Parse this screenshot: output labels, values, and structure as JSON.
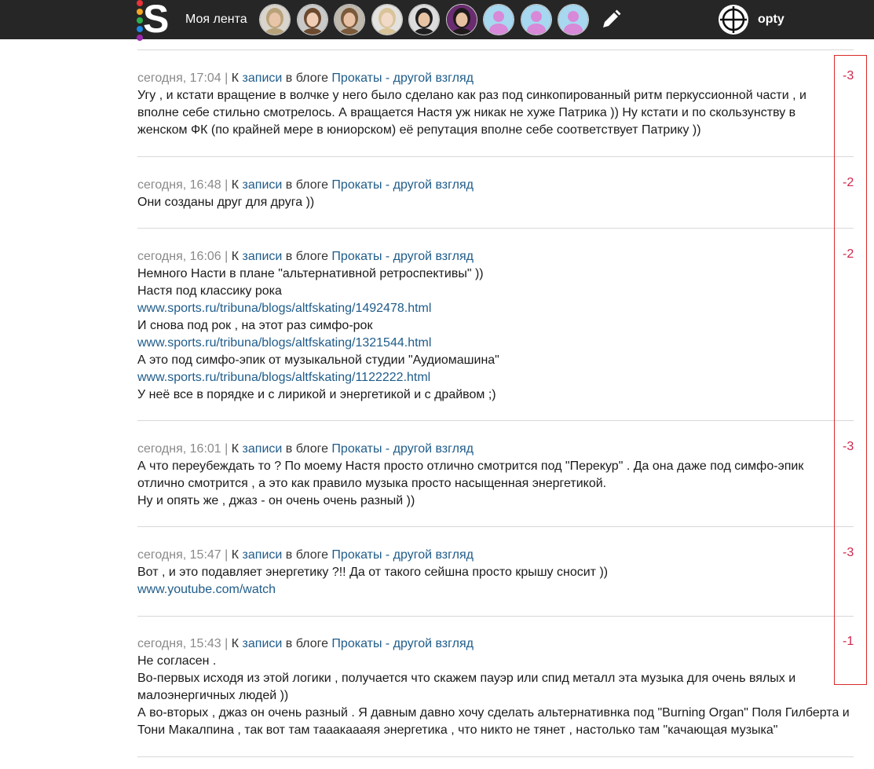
{
  "header": {
    "logo_letter": "S",
    "logo_dot_colors": [
      "#e8333a",
      "#f5a623",
      "#2bb24c",
      "#1e88e5",
      "#9c27b0"
    ],
    "feed_label": "Моя лента",
    "avatars": [
      {
        "name": "avatar-1",
        "kind": "photo",
        "bg": "#d9d4cc",
        "skin": "#e8c4a8",
        "hair": "#b8a27a"
      },
      {
        "name": "avatar-2",
        "kind": "photo",
        "bg": "#c9c9c9",
        "skin": "#f0cdb5",
        "hair": "#6b4a2f"
      },
      {
        "name": "avatar-3",
        "kind": "photo",
        "bg": "#bfb8ad",
        "skin": "#e9c2a6",
        "hair": "#7a5a3a"
      },
      {
        "name": "avatar-4",
        "kind": "photo",
        "bg": "#e4e2df",
        "skin": "#f2dac8",
        "hair": "#d9c49a"
      },
      {
        "name": "avatar-5",
        "kind": "photo",
        "bg": "#dcdcdc",
        "skin": "#e7c3a3",
        "hair": "#1f1f1f"
      },
      {
        "name": "avatar-6",
        "kind": "photo",
        "bg": "#6a2c70",
        "skin": "#e6c0a0",
        "hair": "#1f1a1a"
      },
      {
        "name": "avatar-7",
        "kind": "default",
        "bg": "#a7d8f0",
        "skin": "#d889d8"
      },
      {
        "name": "avatar-8",
        "kind": "default",
        "bg": "#a7d8f0",
        "skin": "#d889d8"
      },
      {
        "name": "avatar-9",
        "kind": "default",
        "bg": "#a7d8f0",
        "skin": "#d889d8"
      }
    ],
    "pencil_icon": "pencil-icon",
    "username": "opty"
  },
  "comments": [
    {
      "time": "сегодня, 17:04",
      "pipe": "|",
      "prefix": "К",
      "link": "записи",
      "mid": "в блоге",
      "blog": "Прокаты - другой взгляд",
      "score": "-3",
      "lines": [
        {
          "text": "Угу , и кстати вращение в волчке у него было сделано как раз под синкопированный ритм перкуссионной части , и",
          "link": false
        },
        {
          "text": "вполне себе стильно смотрелось. А вращается Настя уж никак не хуже Патрика )) Ну кстати и по скользунству в",
          "link": false
        },
        {
          "text": "женском ФК (по крайней мере в юниорском) её репутация вполне себе соответствует Патрику ))",
          "link": false
        }
      ]
    },
    {
      "time": "сегодня, 16:48",
      "pipe": "|",
      "prefix": "К",
      "link": "записи",
      "mid": "в блоге",
      "blog": "Прокаты - другой взгляд",
      "score": "-2",
      "lines": [
        {
          "text": "Они созданы друг для друга ))",
          "link": false
        }
      ]
    },
    {
      "time": "сегодня, 16:06",
      "pipe": "|",
      "prefix": "К",
      "link": "записи",
      "mid": "в блоге",
      "blog": "Прокаты - другой взгляд",
      "score": "-2",
      "lines": [
        {
          "text": "Немного Насти в плане \"альтернативной ретроспективы\" ))",
          "link": false
        },
        {
          "text": "Настя под классику рока",
          "link": false
        },
        {
          "text": "www.sports.ru/tribuna/blogs/altfskating/1492478.html",
          "link": true
        },
        {
          "text": "И снова под рок , на этот раз симфо-рок",
          "link": false
        },
        {
          "text": "www.sports.ru/tribuna/blogs/altfskating/1321544.html",
          "link": true
        },
        {
          "text": "А это под симфо-эпик от музыкальной студии \"Аудиомашина\"",
          "link": false
        },
        {
          "text": "www.sports.ru/tribuna/blogs/altfskating/1122222.html",
          "link": true
        },
        {
          "text": "У неё все в порядке и с лирикой и энергетикой и с драйвом ;)",
          "link": false
        }
      ]
    },
    {
      "time": "сегодня, 16:01",
      "pipe": "|",
      "prefix": "К",
      "link": "записи",
      "mid": "в блоге",
      "blog": "Прокаты - другой взгляд",
      "score": "-3",
      "lines": [
        {
          "text": "А что переубеждать то ? По моему Настя просто отлично смотрится под \"Перекур\" . Да она даже под симфо-эпик",
          "link": false
        },
        {
          "text": "отлично смотрится , а это как правило музыка просто насыщенная энергетикой.",
          "link": false
        },
        {
          "text": "Ну и опять же , джаз - он очень очень разный ))",
          "link": false
        }
      ]
    },
    {
      "time": "сегодня, 15:47",
      "pipe": "|",
      "prefix": "К",
      "link": "записи",
      "mid": "в блоге",
      "blog": "Прокаты - другой взгляд",
      "score": "-3",
      "lines": [
        {
          "text": "Вот , и это подавляет энергетику ?!! Да от такого сейшна просто крышу сносит ))",
          "link": false
        },
        {
          "text": "www.youtube.com/watch",
          "link": true
        }
      ]
    },
    {
      "time": "сегодня, 15:43",
      "pipe": "|",
      "prefix": "К",
      "link": "записи",
      "mid": "в блоге",
      "blog": "Прокаты - другой взгляд",
      "score": "-1",
      "lines": [
        {
          "text": "Не согласен .",
          "link": false
        },
        {
          "text": "Во-первых исходя из этой логики , получается что скажем пауэр или спид металл эта музыка для очень вялых и",
          "link": false
        },
        {
          "text": "малоэнергичных людей ))",
          "link": false
        },
        {
          "text": "А во-вторых , джаз он очень разный . Я давным давно хочу сделать альтернативнка под \"Burning Organ\" Поля Гилберта и",
          "link": false
        },
        {
          "text": "Тони Макалпина , так вот там тааакаааяя энергетика , что никто не тянет , настолько там \"качающая музыка\"",
          "link": false
        }
      ]
    }
  ],
  "colors": {
    "topbar": "#262626",
    "link": "#1f5c8a",
    "meta_gray": "#8a8a8a",
    "score": "#d0264d",
    "highlight": "#d92a2a",
    "separator": "#d8d8d8"
  }
}
